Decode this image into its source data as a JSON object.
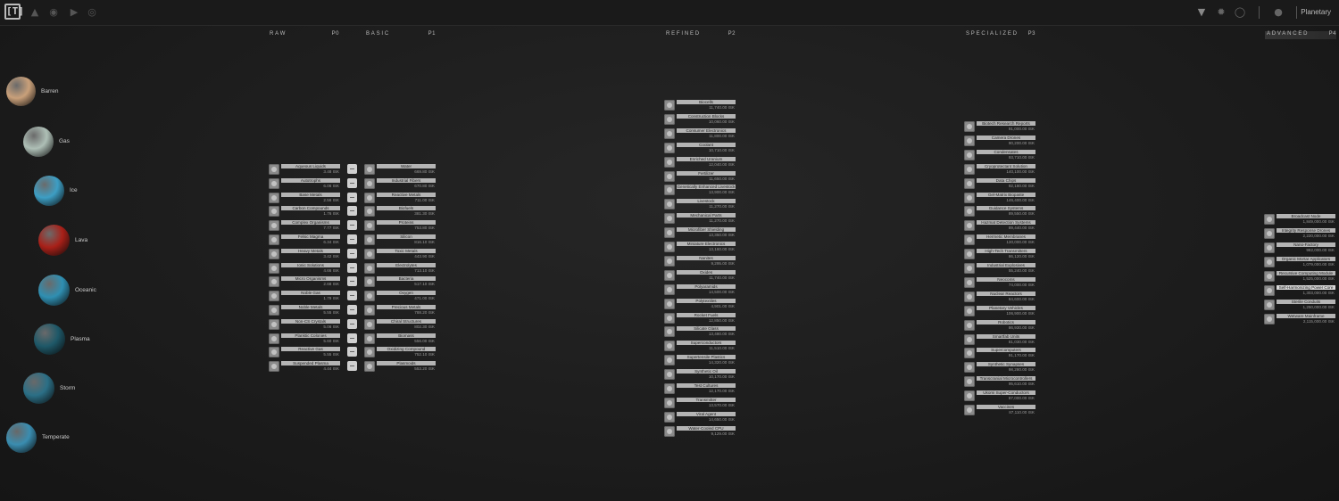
{
  "topbar": {
    "logo": "[T]",
    "mode": "Planetary",
    "icons_left": [
      "flame-icon",
      "planet-icon",
      "play-icon",
      "globe-icon"
    ],
    "icons_right": [
      "grid-icon",
      "gear-icon",
      "circle-icon",
      "person-icon"
    ]
  },
  "columns": {
    "raw": {
      "title": "Raw",
      "code": "P0"
    },
    "basic": {
      "title": "Basic",
      "code": "P1"
    },
    "refined": {
      "title": "Refined",
      "code": "P2"
    },
    "specialized": {
      "title": "Specialized",
      "code": "P3"
    },
    "advanced": {
      "title": "Advanced",
      "code": "P4"
    }
  },
  "planets": [
    {
      "name": "Barren",
      "color": "#c9a07a"
    },
    {
      "name": "Gas",
      "color": "#aebfb6"
    },
    {
      "name": "Ice",
      "color": "#3d9ec4"
    },
    {
      "name": "Lava",
      "color": "#a82018"
    },
    {
      "name": "Oceanic",
      "color": "#2f8fb2"
    },
    {
      "name": "Plasma",
      "color": "#1e5868"
    },
    {
      "name": "Storm",
      "color": "#2b6f86"
    },
    {
      "name": "Temperate",
      "color": "#3a8db0"
    }
  ],
  "raw": [
    {
      "name": "Aqueous Liquids",
      "price": "3.48 ISK"
    },
    {
      "name": "Autotrophs",
      "price": "6.06 ISK"
    },
    {
      "name": "Base Metals",
      "price": "2.56 ISK"
    },
    {
      "name": "Carbon Compounds",
      "price": "1.76 ISK"
    },
    {
      "name": "Complex Organisms",
      "price": "7.77 ISK"
    },
    {
      "name": "Felsic Magma",
      "price": "6.34 ISK"
    },
    {
      "name": "Heavy Metals",
      "price": "3.42 ISK"
    },
    {
      "name": "Ionic Solutions",
      "price": "4.66 ISK"
    },
    {
      "name": "Micro Organisms",
      "price": "2.68 ISK"
    },
    {
      "name": "Noble Gas",
      "price": "1.79 ISK"
    },
    {
      "name": "Noble Metals",
      "price": "5.55 ISK"
    },
    {
      "name": "Non-CS Crystals",
      "price": "5.06 ISK"
    },
    {
      "name": "Planktic Colonies",
      "price": "5.60 ISK"
    },
    {
      "name": "Reactive Gas",
      "price": "5.55 ISK"
    },
    {
      "name": "Suspended Plasma",
      "price": "4.44 ISK"
    }
  ],
  "basic": [
    {
      "name": "Water",
      "price": "669.80 ISK"
    },
    {
      "name": "Industrial Fibers",
      "price": "670.80 ISK"
    },
    {
      "name": "Reactive Metals",
      "price": "711.00 ISK"
    },
    {
      "name": "Biofuels",
      "price": "381.30 ISK"
    },
    {
      "name": "Proteins",
      "price": "753.80 ISK"
    },
    {
      "name": "Silicon",
      "price": "816.10 ISK"
    },
    {
      "name": "Toxic Metals",
      "price": "443.90 ISK"
    },
    {
      "name": "Electrolytes",
      "price": "713.10 ISK"
    },
    {
      "name": "Bacteria",
      "price": "517.10 ISK"
    },
    {
      "name": "Oxygen",
      "price": "471.00 ISK"
    },
    {
      "name": "Precious Metals",
      "price": "788.20 ISK"
    },
    {
      "name": "Chiral Structures",
      "price": "802.30 ISK"
    },
    {
      "name": "Biomass",
      "price": "556.00 ISK"
    },
    {
      "name": "Oxidizing Compound",
      "price": "752.10 ISK"
    },
    {
      "name": "Plasmoids",
      "price": "553.20 ISK"
    }
  ],
  "refined": [
    {
      "name": "Biocells",
      "price": "11,740.00 ISK"
    },
    {
      "name": "Construction Blocks",
      "price": "10,060.00 ISK"
    },
    {
      "name": "Consumer Electronics",
      "price": "11,800.00 ISK"
    },
    {
      "name": "Coolant",
      "price": "10,710.00 ISK"
    },
    {
      "name": "Enriched Uranium",
      "price": "12,040.00 ISK"
    },
    {
      "name": "Fertilizer",
      "price": "11,650.00 ISK"
    },
    {
      "name": "Genetically Enhanced Livestock",
      "price": "13,900.00 ISK"
    },
    {
      "name": "Livestock",
      "price": "11,270.00 ISK"
    },
    {
      "name": "Mechanical Parts",
      "price": "11,270.00 ISK"
    },
    {
      "name": "Microfiber Shielding",
      "price": "13,350.00 ISK"
    },
    {
      "name": "Miniature Electronics",
      "price": "13,160.00 ISK"
    },
    {
      "name": "Nanites",
      "price": "9,295.00 ISK"
    },
    {
      "name": "Oxides",
      "price": "11,740.00 ISK"
    },
    {
      "name": "Polyaramids",
      "price": "14,500.00 ISK"
    },
    {
      "name": "Polytextiles",
      "price": "4,901.00 ISK"
    },
    {
      "name": "Rocket Fuels",
      "price": "12,850.00 ISK"
    },
    {
      "name": "Silicate Glass",
      "price": "13,480.00 ISK"
    },
    {
      "name": "Superconductors",
      "price": "11,510.00 ISK"
    },
    {
      "name": "Supertensile Plastics",
      "price": "14,320.00 ISK"
    },
    {
      "name": "Synthetic Oil",
      "price": "10,170.00 ISK"
    },
    {
      "name": "Test Cultures",
      "price": "12,170.00 ISK"
    },
    {
      "name": "Transmitter",
      "price": "13,570.00 ISK"
    },
    {
      "name": "Viral Agent",
      "price": "14,650.00 ISK"
    },
    {
      "name": "Water-Cooled CPU",
      "price": "9,129.00 ISK"
    }
  ],
  "specialized": [
    {
      "name": "Biotech Research Reports",
      "price": "91,000.00 ISK"
    },
    {
      "name": "Camera Drones",
      "price": "90,200.00 ISK"
    },
    {
      "name": "Condensates",
      "price": "93,710.00 ISK"
    },
    {
      "name": "Cryoprotectant Solution",
      "price": "140,100.00 ISK"
    },
    {
      "name": "Data Chips",
      "price": "92,180.00 ISK"
    },
    {
      "name": "Gel-Matrix Biopaste",
      "price": "146,400.00 ISK"
    },
    {
      "name": "Guidance Systems",
      "price": "89,550.00 ISK"
    },
    {
      "name": "Hazmat Detection Systems",
      "price": "89,440.00 ISK"
    },
    {
      "name": "Hermetic Membranes",
      "price": "130,000.00 ISK"
    },
    {
      "name": "High-Tech Transmitters",
      "price": "86,120.00 ISK"
    },
    {
      "name": "Industrial Explosives",
      "price": "55,240.00 ISK"
    },
    {
      "name": "Neocoms",
      "price": "74,000.00 ISK"
    },
    {
      "name": "Nuclear Reactors",
      "price": "84,600.00 ISK"
    },
    {
      "name": "Planetary Vehicles",
      "price": "106,900.00 ISK"
    },
    {
      "name": "Robotics",
      "price": "86,930.00 ISK"
    },
    {
      "name": "Smartfab Units",
      "price": "81,030.00 ISK"
    },
    {
      "name": "Supercomputers",
      "price": "91,170.00 ISK"
    },
    {
      "name": "Synthetic Synapses",
      "price": "98,280.00 ISK"
    },
    {
      "name": "Transcranial Microcontrollers",
      "price": "95,610.00 ISK"
    },
    {
      "name": "Ukomi Super-Conductors",
      "price": "87,000.00 ISK"
    },
    {
      "name": "Vaccines",
      "price": "87,110.00 ISK"
    }
  ],
  "advanced": [
    {
      "name": "Broadcast Node",
      "price": "1,849,000.00 ISK"
    },
    {
      "name": "Integrity Response Drones",
      "price": "2,220,000.00 ISK"
    },
    {
      "name": "Nano-Factory",
      "price": "982,000.00 ISK"
    },
    {
      "name": "Organic Mortar Applicators",
      "price": "1,079,000.00 ISK"
    },
    {
      "name": "Recursive Computing Module",
      "price": "1,525,000.00 ISK"
    },
    {
      "name": "Self-Harmonizing Power Core",
      "price": "1,303,000.00 ISK"
    },
    {
      "name": "Sterile Conduits",
      "price": "1,250,000.00 ISK"
    },
    {
      "name": "Wetware Mainframe",
      "price": "2,115,000.00 ISK"
    }
  ]
}
